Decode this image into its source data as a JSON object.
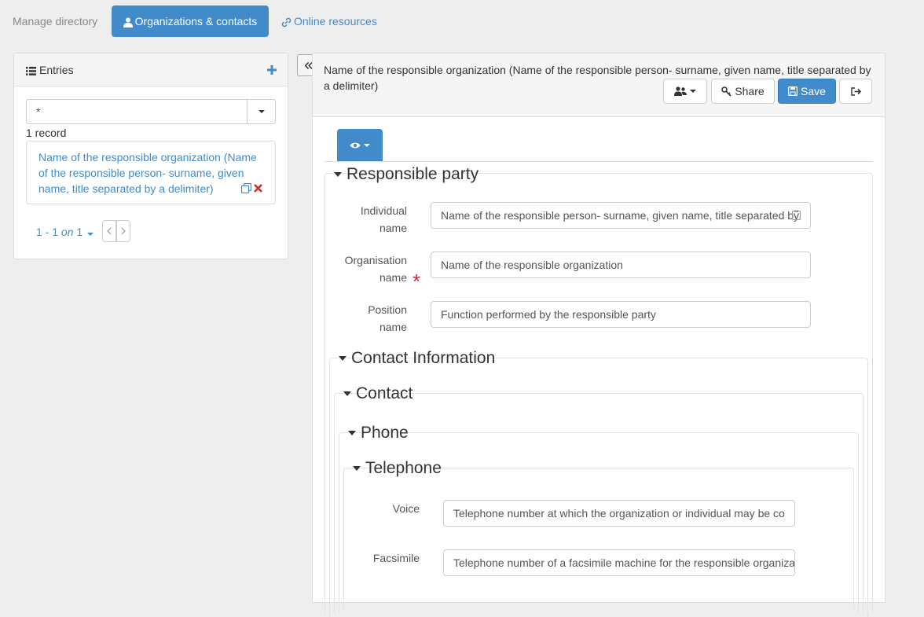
{
  "nav": {
    "manage": "Manage directory",
    "organizations": "Organizations & contacts",
    "online": "Online resources"
  },
  "left": {
    "title": "Entries",
    "search_value": "*",
    "record_count": "1 record",
    "result_text": "Name of the responsible organization (Name of the responsible person- surname, given name, title separated by a delimiter)",
    "pager_range": "1 - 1",
    "pager_on": "on",
    "pager_total": "1"
  },
  "editor": {
    "title": "Name of the responsible organization (Name of the responsible person- surname, given name, title separated by a delimiter)",
    "share_label": "Share",
    "save_label": "Save"
  },
  "sections": {
    "responsible_party": "Responsible party",
    "contact_information": "Contact Information",
    "contact": "Contact",
    "phone": "Phone",
    "telephone": "Telephone"
  },
  "fields": {
    "individual_name": {
      "label1": "Individual",
      "label2": "name",
      "value": "Name of the responsible person- surname, given name, title separated by"
    },
    "organisation_name": {
      "label1": "Organisation",
      "label2": "name",
      "value": "Name of the responsible organization"
    },
    "position_name": {
      "label1": "Position",
      "label2": "name",
      "value": "Function performed by the responsible party"
    },
    "voice": {
      "label": "Voice",
      "value": "Telephone number at which the organization or individual may be co"
    },
    "facsimile": {
      "label": "Facsimile",
      "value": "Telephone number of a facsimile machine for the responsible organiza"
    }
  },
  "colors": {
    "primary": "#428bca",
    "danger": "#c9302c"
  }
}
